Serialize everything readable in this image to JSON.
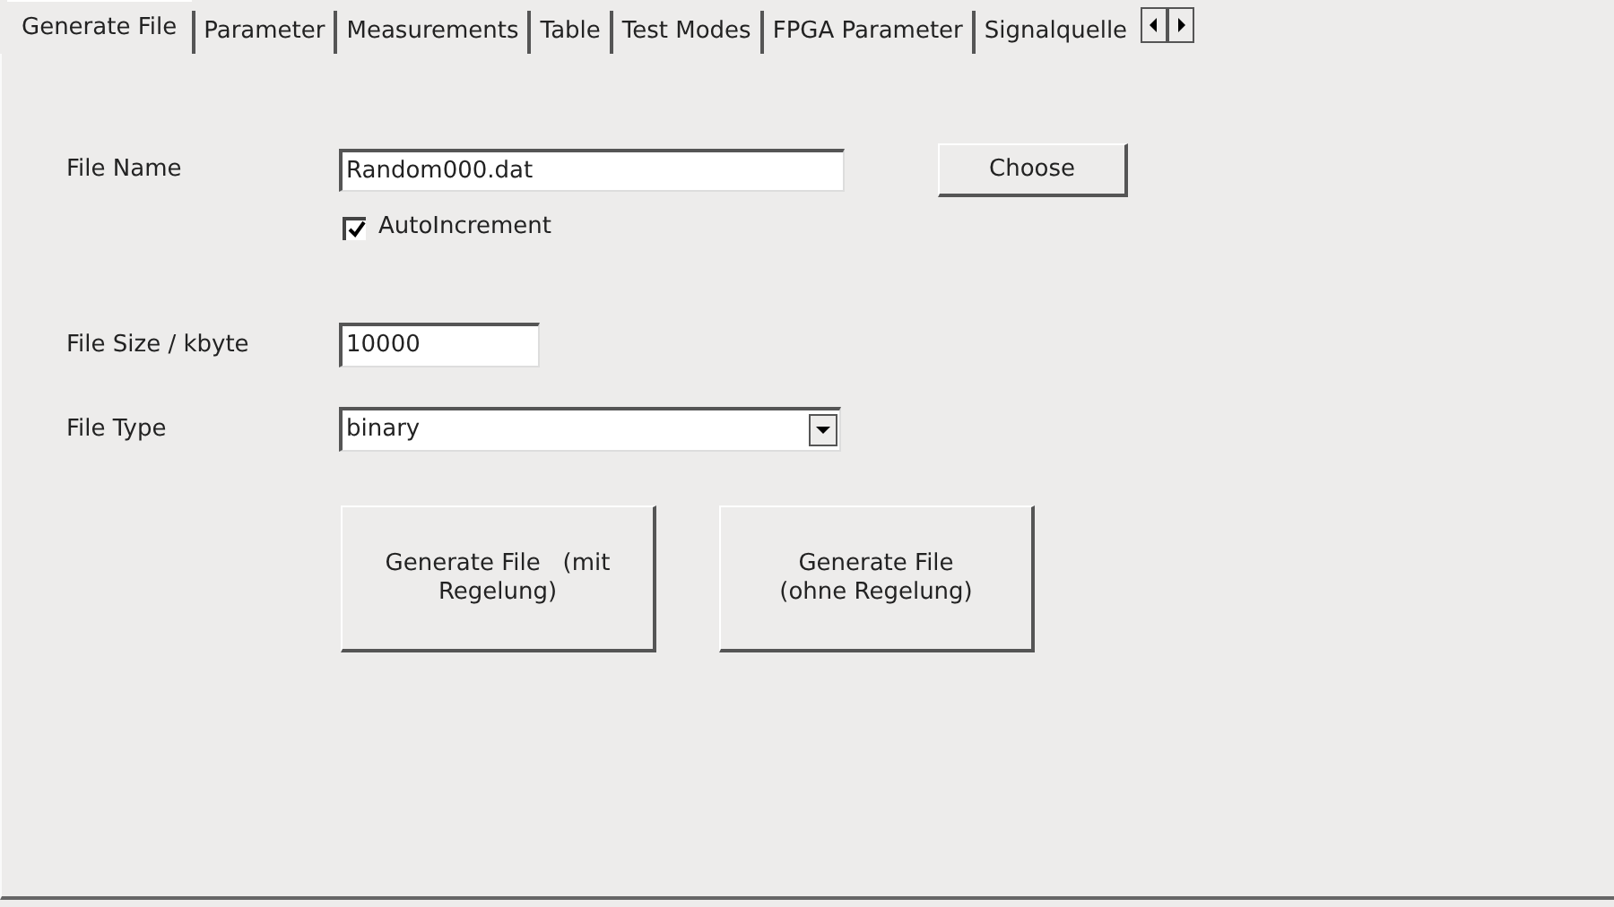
{
  "tabs": [
    {
      "label": "Generate File",
      "selected": true
    },
    {
      "label": "Parameter",
      "selected": false
    },
    {
      "label": "Measurements",
      "selected": false
    },
    {
      "label": "Table",
      "selected": false
    },
    {
      "label": "Test Modes",
      "selected": false
    },
    {
      "label": "FPGA Parameter",
      "selected": false
    },
    {
      "label": "Signalquelle",
      "selected": false
    }
  ],
  "form": {
    "file_name": {
      "label": "File Name",
      "value": "Random000.dat",
      "button": "Choose"
    },
    "auto_increment": {
      "label": "AutoIncrement",
      "checked": true
    },
    "file_size": {
      "label": "File Size / kbyte",
      "value": "10000"
    },
    "file_type": {
      "label": "File Type",
      "value": "binary"
    }
  },
  "buttons": [
    "Generate File   (mit\nRegelung)",
    "Generate File\n(ohne Regelung)"
  ]
}
